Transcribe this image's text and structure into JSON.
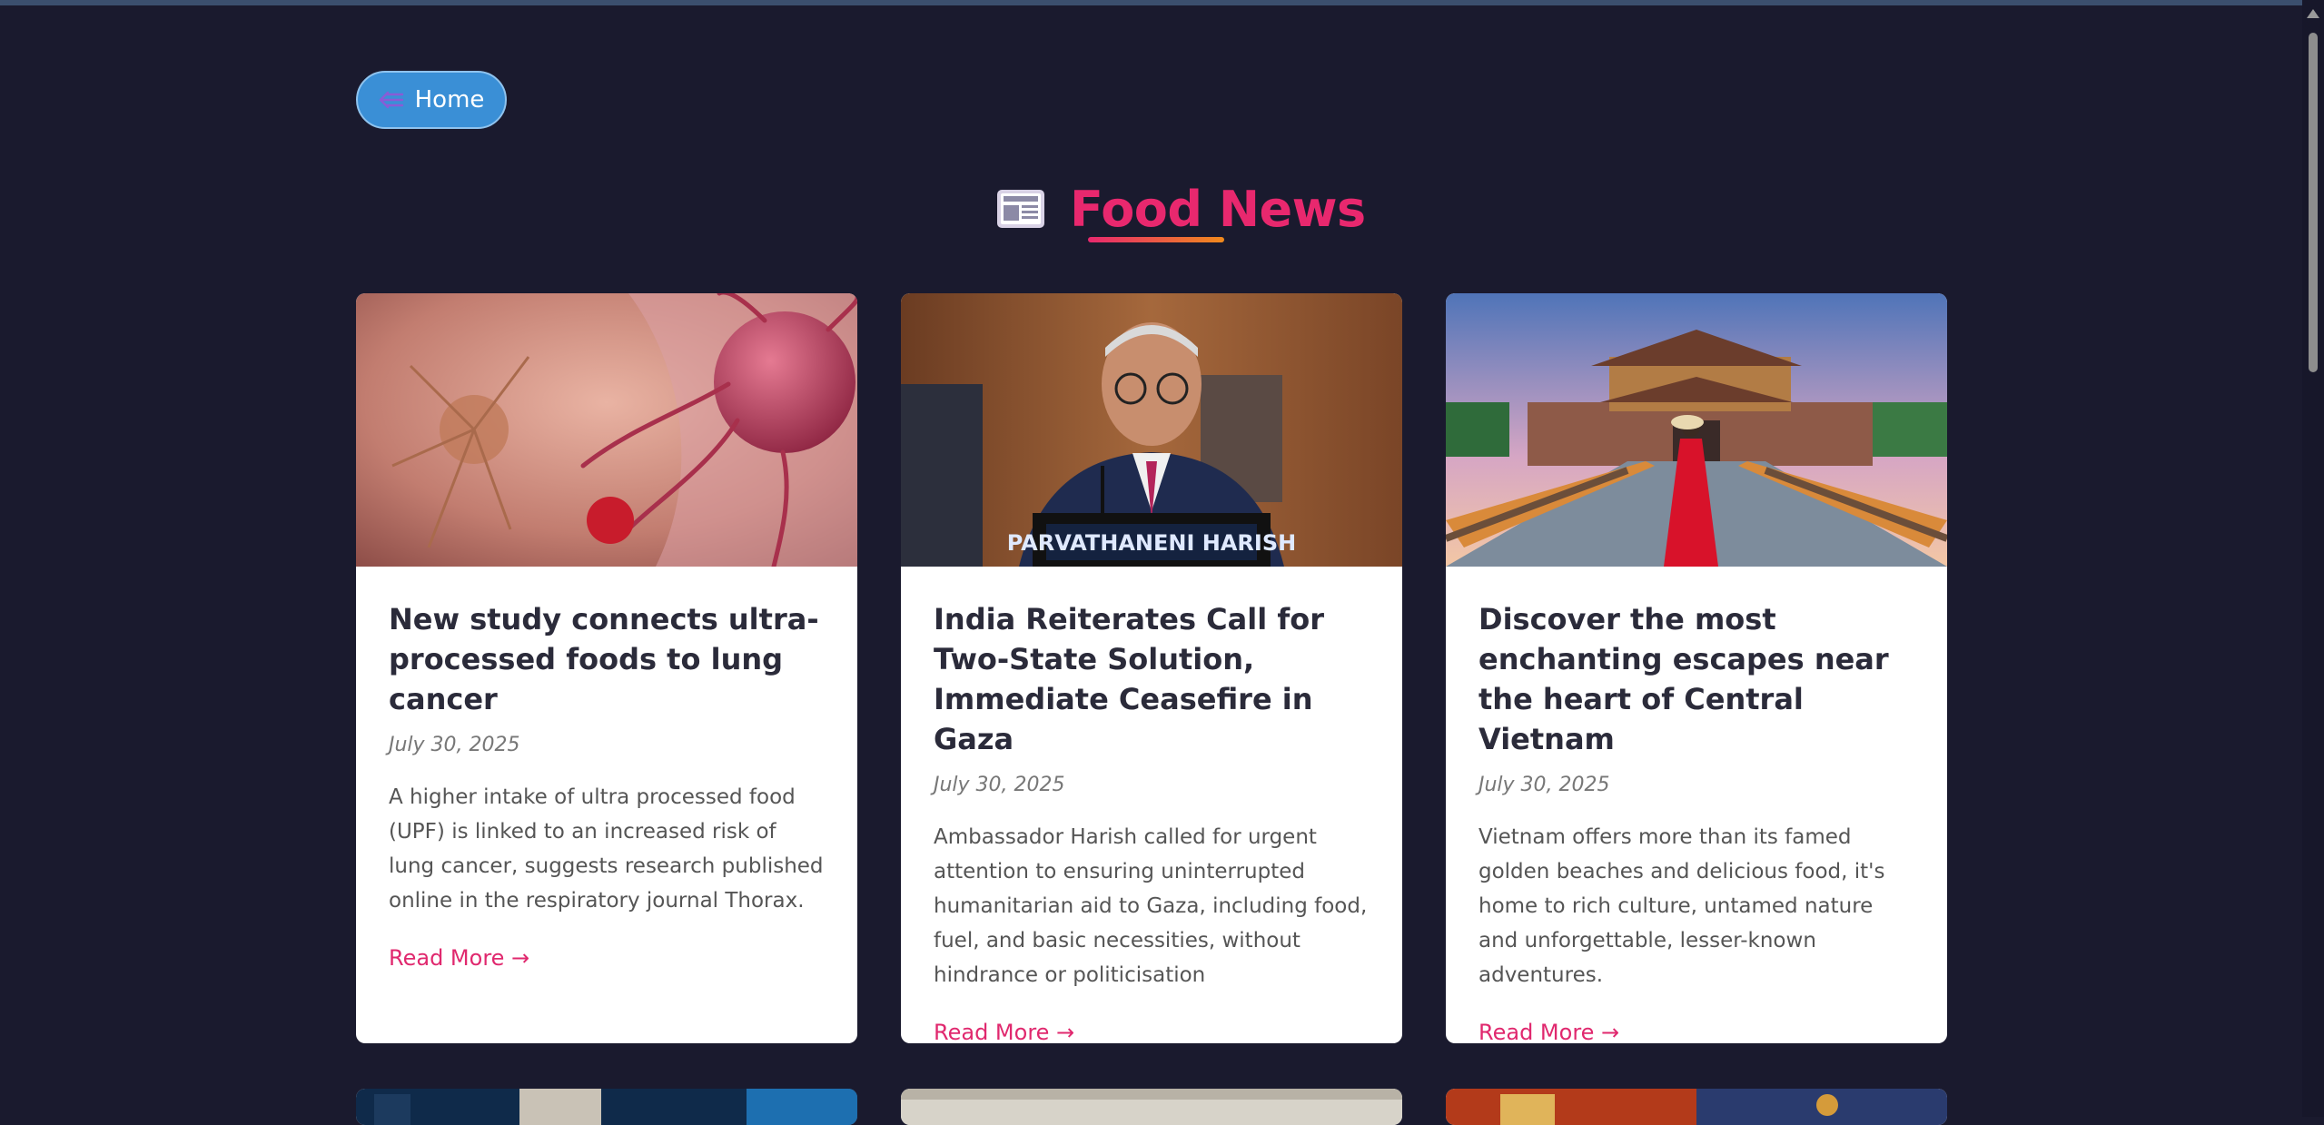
{
  "nav": {
    "home_label": "Home"
  },
  "page": {
    "title": "Food News"
  },
  "articles": [
    {
      "title": "New study connects ultra-processed foods to lung cancer",
      "date": "July 30, 2025",
      "excerpt": "A higher intake of ultra processed food (UPF) is linked to an increased risk of lung cancer, suggests research published online in the respiratory journal Thorax.",
      "read_more": "Read More →"
    },
    {
      "title": "India Reiterates Call for Two-State Solution, Immediate Ceasefire in Gaza",
      "date": "July 30, 2025",
      "excerpt": "Ambassador Harish called for urgent attention to ensuring uninterrupted humanitarian aid to Gaza, including food, fuel, and basic necessities, without hindrance or politicisation",
      "read_more": "Read More →",
      "nameplate": "PARVATHANENI HARISH"
    },
    {
      "title": "Discover the most enchanting escapes near the heart of Central Vietnam",
      "date": "July 30, 2025",
      "excerpt": "Vietnam offers more than its famed golden beaches and delicious food, it's home to rich culture, untamed nature and unforgettable, lesser-known adventures.",
      "read_more": "Read More →"
    }
  ],
  "colors": {
    "background": "#1a1a2e",
    "accent": "#e8286e",
    "button": "#3a8fd6"
  }
}
